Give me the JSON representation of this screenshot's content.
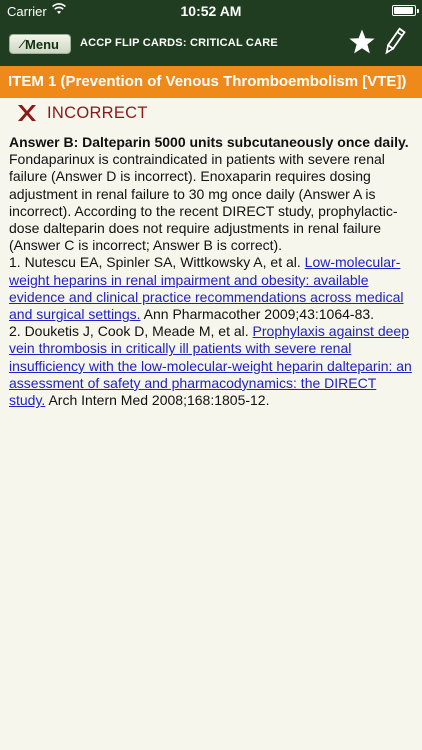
{
  "status_bar": {
    "carrier": "Carrier",
    "time": "10:52 AM",
    "wifi_icon": "wifi-icon",
    "battery_icon": "battery-icon"
  },
  "nav": {
    "menu_label": "Menu",
    "title": "ACCP FLIP CARDS: CRITICAL CARE",
    "star_icon": "star-icon",
    "edit_icon": "pencil-icon"
  },
  "item": {
    "header": "ITEM 1 (Prevention of Venous Thromboembolism [VTE])"
  },
  "result": {
    "icon": "x-icon",
    "label": "INCORRECT",
    "color": "#8e1818"
  },
  "answer": {
    "heading": "Answer B: Dalteparin 5000 units subcutaneously once daily.",
    "explanation": "Fondaparinux is contraindicated in patients with severe renal failure (Answer D is incorrect). Enoxaparin requires dosing adjustment in renal failure to 30 mg once daily (Answer A is incorrect). According to the recent DIRECT study, prophylactic-dose dalteparin does not require adjustments in renal failure (Answer C is incorrect; Answer B is correct).",
    "references": [
      {
        "prefix": "1. Nutescu EA, Spinler SA, Wittkowsky A, et al.",
        "link": "Low-molecular-weight heparins in renal impairment and obesity: available evidence and clinical practice recommendations across medical and surgical settings.",
        "suffix": "Ann Pharmacother 2009;43:1064-83."
      },
      {
        "prefix": "2. Douketis J, Cook D, Meade M, et al.",
        "link": "Prophylaxis against deep vein thrombosis in critically ill patients with severe renal insufficiency with the low-molecular-weight heparin dalteparin: an assessment of safety and pharmacodynamics: the DIRECT study.",
        "suffix": "Arch Intern Med 2008;168:1805-12."
      }
    ]
  },
  "colors": {
    "nav_background": "#213d21",
    "header_background": "#ef8a1a",
    "page_background": "#f6f6ec",
    "link": "#2222c4"
  }
}
